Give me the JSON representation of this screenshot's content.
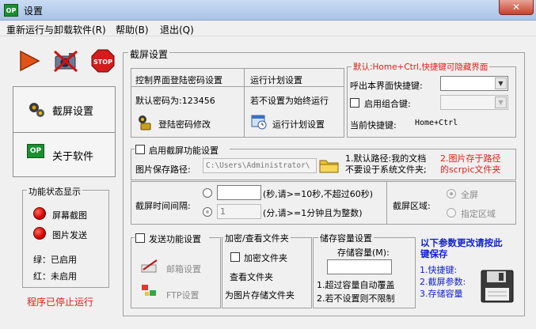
{
  "window": {
    "title": "设置",
    "app_icon_text": "OP",
    "close_glyph": "✕"
  },
  "menu": {
    "items": [
      "重新运行与卸载软件(R)",
      "帮助(B)",
      "退出(Q)"
    ]
  },
  "toolbar": {
    "icons": [
      "play-icon",
      "no-camera-icon",
      "stop-icon"
    ],
    "stop_text": "STOP"
  },
  "nav": {
    "items": [
      {
        "label": "截屏设置",
        "icon": "settings-icon"
      },
      {
        "label": "关于软件",
        "icon": "about-icon",
        "icon_text": "OP"
      }
    ]
  },
  "status_panel": {
    "title": "功能状态显示",
    "items": [
      "屏幕截图",
      "图片发送"
    ],
    "legend_green": "绿：已启用",
    "legend_red": "红：未启用",
    "program_status": "程序已停止运行"
  },
  "main": {
    "title": "截屏设置",
    "login": {
      "title": "控制界面登陆密码设置",
      "default_password": "默认密码为:123456",
      "modify_button": "登陆密码修改"
    },
    "schedule": {
      "title": "运行计划设置",
      "note": "若不设置为始终运行",
      "button": "运行计划设置"
    },
    "hotkey": {
      "default_note": "默认:Home+Ctrl,快捷键可隐藏界面",
      "call_label": "呼出本界面快捷键:",
      "combo_label": "启用组合键:",
      "current_label": "当前快捷键:",
      "current_value": "Home+Ctrl"
    },
    "capture": {
      "enable_label": "启用截屏功能设置",
      "save_path_label": "图片保存路径:",
      "save_path_value": "C:\\Users\\Administrator\\",
      "note1_line1": "1.默认路径:我的文档",
      "note1_line2": "不要设于系统文件夹;",
      "note2_line1": "2.图片存于路径",
      "note2_line2": "的scrpic文件夹"
    },
    "interval": {
      "label": "截屏时间间隔:",
      "sec_value": "",
      "sec_hint": "(秒,请>=10秒,不超过60秒)",
      "min_value": "1",
      "min_hint": "(分,请>=1分钟且为整数)",
      "area_label": "截屏区域:",
      "area_options": [
        "全屏",
        "指定区域"
      ]
    },
    "send": {
      "enable_label": "发送功能设置",
      "mail_button": "邮箱设置",
      "ftp_button": "FTP设置"
    },
    "encrypt": {
      "title": "加密/查看文件夹",
      "encrypt_label": "加密文件夹",
      "view_label": "查看文件夹",
      "for_label": "为图片存储文件夹"
    },
    "storage": {
      "title": "储存容量设置",
      "capacity_label": "存储容量(M):",
      "capacity_value": "",
      "note1": "1.超过容量自动覆盖",
      "note2": "2.若不设置则不限制"
    },
    "save_hint": {
      "line1": "以下参数更改请按此",
      "line2": "键保存",
      "items": [
        "1.快捷键:",
        "2.截屏参数:",
        "3.存储容量"
      ]
    }
  },
  "colors": {
    "accent_red": "#e0201a",
    "accent_blue": "#1122cc",
    "status_red": "#d40000"
  }
}
